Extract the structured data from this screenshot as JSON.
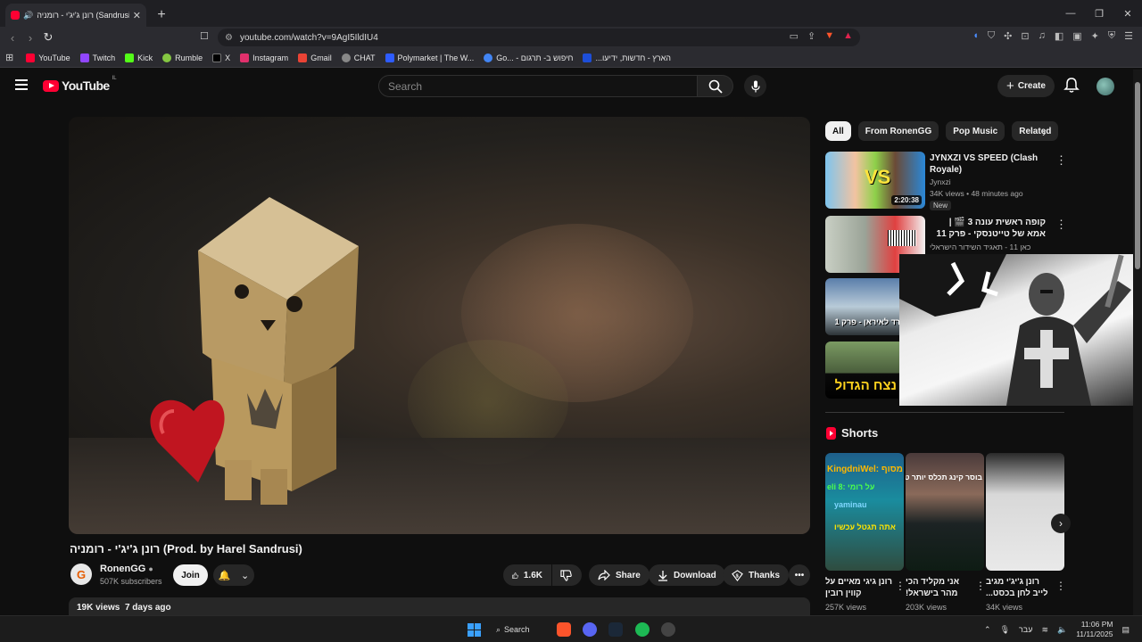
{
  "browser": {
    "tab_title": "רונן ג'יג'י - רומניה (Sandrusi)",
    "url": "youtube.com/watch?v=9AgI5IldIU4",
    "bookmarks": [
      "YouTube",
      "Twitch",
      "Kick",
      "Rumble",
      "X",
      "Instagram",
      "Gmail",
      "CHAT",
      "Polymarket | The W...",
      "Go... - חיפוש ב- תרגום",
      "...הארץ - חדשות, ידיעו"
    ],
    "bookmark_colors": [
      "#ff0033",
      "#9146ff",
      "#53fc18",
      "#85c742",
      "#000000",
      "#e1306c",
      "#ea4335",
      "#888888",
      "#2e5cff",
      "#4285f4",
      "#1d4ed8"
    ]
  },
  "header": {
    "logo_text": "YouTube",
    "country": "IL",
    "search_placeholder": "Search",
    "create_label": "Create"
  },
  "video": {
    "title": "רונן ג'יג'י - רומניה (Prod. by Harel Sandrusi)",
    "channel": "RonenGG",
    "channel_initial": "G",
    "subscribers": "507K subscribers",
    "join_label": "Join",
    "likes": "1.6K",
    "share_label": "Share",
    "download_label": "Download",
    "thanks_label": "Thanks",
    "views": "19K views",
    "age": "7 days ago"
  },
  "chips": [
    "All",
    "From RonenGG",
    "Pop Music",
    "Related"
  ],
  "recommendations": [
    {
      "title": "JYNXZI VS SPEED (Clash Royale)",
      "channel": "Jynxzi",
      "meta": "34K views • 48 minutes ago",
      "duration": "2:20:38",
      "badge": "New"
    },
    {
      "title": "קופה ראשית עונה 3 🎬 | אמא של טייטנסקי - פרק 11",
      "channel": "כאן 11 - תאגיד השידור הישראלי",
      "meta": "",
      "duration": "",
      "badge": ""
    },
    {
      "title": "",
      "channel": "",
      "meta": "",
      "duration": "",
      "badge": ""
    },
    {
      "title": "",
      "channel": "",
      "meta": "",
      "duration": "",
      "badge": ""
    }
  ],
  "thumb_texts": {
    "rec3": "רד לאיראן - פרק 1",
    "rec4": "נצח הגדול"
  },
  "shorts": {
    "heading": "Shorts",
    "items": [
      {
        "title": "רונן גיגי מאיים על קווין רובין",
        "views": "257K views",
        "overlay1": "KingdniWel: על מסוף",
        "overlay2": "eli 8: על רומי",
        "overlay3": "yaminau",
        "overlay4": "אתה תגטל עכשיו"
      },
      {
        "title": "אני מקליד הכי מהר בישראל!",
        "views": "203K views",
        "overlay1": "בוסר קינג תכלס יותר טעים"
      },
      {
        "title": "רונן ג'יג'י מגיב לייב לחן בכסט...",
        "views": "34K views",
        "overlay1": ""
      }
    ]
  },
  "taskbar": {
    "search_label": "Search",
    "lang": "עבר",
    "time": "11:06 PM",
    "date": "11/11/2025"
  }
}
